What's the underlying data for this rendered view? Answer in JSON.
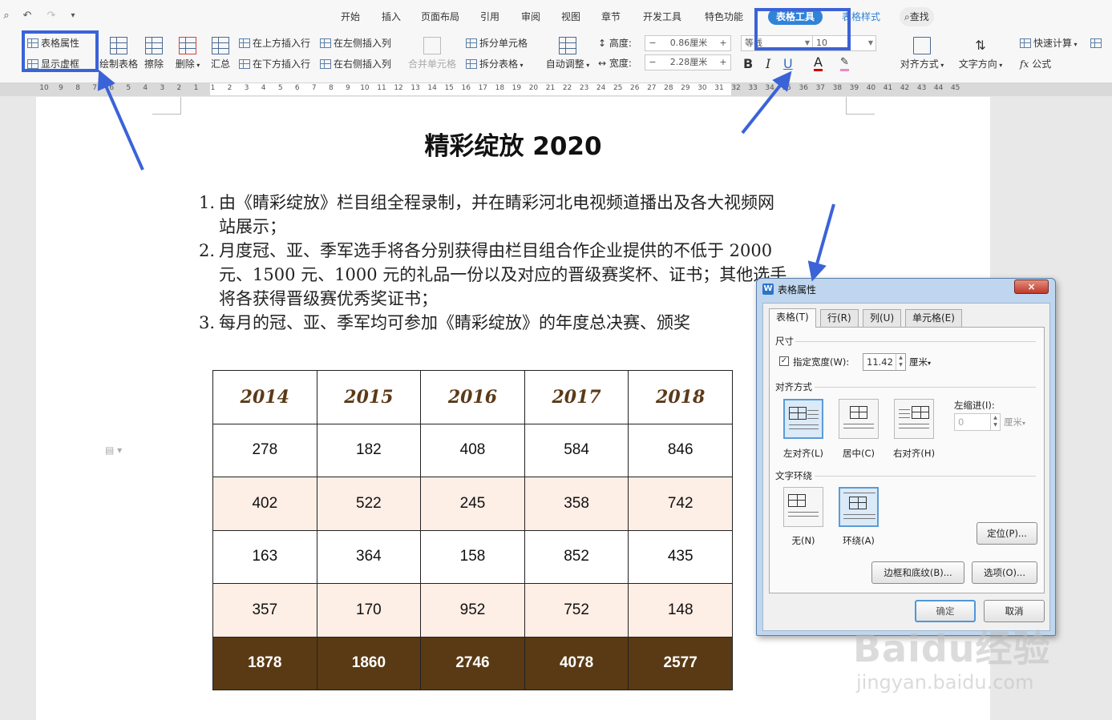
{
  "quick_access": [
    "↶",
    "↷",
    "▾"
  ],
  "tabs": [
    {
      "label": "开始"
    },
    {
      "label": "插入"
    },
    {
      "label": "页面布局"
    },
    {
      "label": "引用"
    },
    {
      "label": "审阅"
    },
    {
      "label": "视图"
    },
    {
      "label": "章节"
    },
    {
      "label": "开发工具"
    },
    {
      "label": "特色功能"
    },
    {
      "label": "表格工具"
    },
    {
      "label": "表格样式"
    },
    {
      "label": "查找"
    }
  ],
  "ribbon": {
    "table_properties": "表格属性",
    "show_gridlines": "显示虚框",
    "draw_table": "绘制表格",
    "erase": "擦除",
    "delete": "删除",
    "summary": "汇总",
    "insert_row_above": "在上方插入行",
    "insert_row_below": "在下方插入行",
    "insert_col_left": "在左侧插入列",
    "insert_col_right": "在右侧插入列",
    "merge_cells": "合并单元格",
    "split_cells": "拆分单元格",
    "split_table": "拆分表格",
    "auto_fit": "自动调整",
    "height_label": "高度:",
    "height_value": "0.86厘米",
    "width_label": "宽度:",
    "width_value": "2.28厘米",
    "font_name": "等线",
    "font_size": "10",
    "bold": "B",
    "italic": "I",
    "underline": "U",
    "font_color": "A",
    "align": "对齐方式",
    "text_direction": "文字方向",
    "quick_calc": "快速计算",
    "formula": "公式"
  },
  "ruler_ticks": [
    "10",
    "9",
    "8",
    "7",
    "6",
    "5",
    "4",
    "3",
    "2",
    "1",
    "1",
    "2",
    "3",
    "4",
    "5",
    "6",
    "7",
    "8",
    "9",
    "10",
    "11",
    "12",
    "13",
    "14",
    "15",
    "16",
    "17",
    "18",
    "19",
    "20",
    "21",
    "22",
    "23",
    "24",
    "25",
    "26",
    "27",
    "28",
    "29",
    "30",
    "31",
    "32",
    "33",
    "34",
    "35",
    "36",
    "37",
    "38",
    "39",
    "40",
    "41",
    "42",
    "43",
    "44",
    "45"
  ],
  "document": {
    "title": "精彩绽放 2020",
    "items": [
      {
        "num": "1.",
        "lines": [
          "由《睛彩绽放》栏目组全程录制，并在睛彩河北电视频道播出及各大视频网",
          "站展示；"
        ]
      },
      {
        "num": "2.",
        "lines": [
          "月度冠、亚、季军选手将各分别获得由栏目组合作企业提供的不低于 2000",
          "元、1500 元、1000 元的礼品一份以及对应的晋级赛奖杯、证书；其他选手",
          "将各获得晋级赛优秀奖证书；"
        ]
      },
      {
        "num": "3.",
        "lines": [
          "每月的冠、亚、季军均可参加《睛彩绽放》的年度总决赛、颁奖"
        ]
      }
    ],
    "table": {
      "headers": [
        "2014",
        "2015",
        "2016",
        "2017",
        "2018"
      ],
      "rows": [
        [
          "278",
          "182",
          "408",
          "584",
          "846"
        ],
        [
          "402",
          "522",
          "245",
          "358",
          "742"
        ],
        [
          "163",
          "364",
          "158",
          "852",
          "435"
        ],
        [
          "357",
          "170",
          "952",
          "752",
          "148"
        ]
      ],
      "totals": [
        "1878",
        "1860",
        "2746",
        "4078",
        "2577"
      ],
      "colors": {
        "header_text": "#5b3a18",
        "alt_row": "#fdeee6",
        "total_bg": "#5a3a14"
      }
    }
  },
  "dialog": {
    "title": "表格属性",
    "close": "×",
    "tabs": [
      "表格(T)",
      "行(R)",
      "列(U)",
      "单元格(E)"
    ],
    "size_group": "尺寸",
    "width_check_label": "指定宽度(W):",
    "width_value": "11.42",
    "width_unit": "厘米",
    "align_group": "对齐方式",
    "align_left": "左对齐(L)",
    "align_center": "居中(C)",
    "align_right": "右对齐(H)",
    "indent_label": "左缩进(I):",
    "indent_value": "0",
    "indent_unit": "厘米",
    "wrap_group": "文字环绕",
    "wrap_none": "无(N)",
    "wrap_around": "环绕(A)",
    "position_button": "定位(P)...",
    "borders_button": "边框和底纹(B)...",
    "options_button": "选项(O)...",
    "ok_button": "确定",
    "cancel_button": "取消"
  },
  "watermark": {
    "logo": "Baidu经验",
    "url": "jingyan.baidu.com"
  },
  "annotation_color": "#3b63d8"
}
